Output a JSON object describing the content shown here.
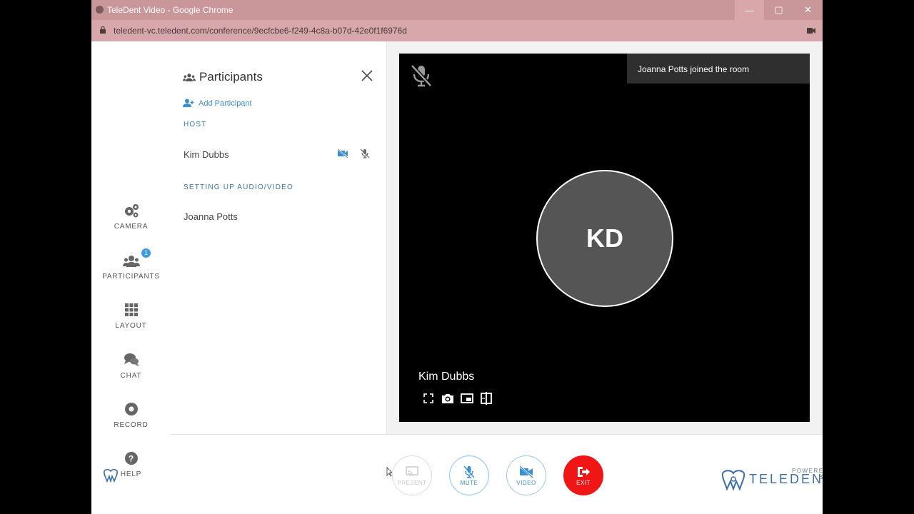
{
  "window": {
    "title": "TeleDent Video - Google Chrome",
    "url": "teledent-vc.teledent.com/conference/9ecfcbe6-f249-4c8a-b07d-42e0f1f6976d"
  },
  "leftnav": {
    "items": [
      {
        "label": "CAMERA",
        "icon": "gear-cogs-icon"
      },
      {
        "label": "PARTICIPANTS",
        "icon": "users-icon",
        "badge": "1"
      },
      {
        "label": "LAYOUT",
        "icon": "grid-icon"
      },
      {
        "label": "CHAT",
        "icon": "chat-icon"
      },
      {
        "label": "RECORD",
        "icon": "record-icon"
      },
      {
        "label": "HELP",
        "icon": "help-icon"
      }
    ]
  },
  "panel": {
    "title": "Participants",
    "add_label": "Add Participant",
    "host_heading": "HOST",
    "host_name": "Kim Dubbs",
    "setup_heading": "SETTING UP AUDIO/VIDEO",
    "setup_name": "Joanna Potts"
  },
  "stage": {
    "toast": "Joanna Potts joined the room",
    "initials": "KD",
    "name": "Kim Dubbs"
  },
  "controls": {
    "present": "PRESENT",
    "mute": "MUTE",
    "video": "VIDEO",
    "exit": "EXIT"
  },
  "brand": {
    "powered_by": "POWERED BY",
    "name": "TELEDENT"
  },
  "colors": {
    "accent": "#3c8ed0",
    "exit": "#f01616",
    "titlebar": "#c9969a"
  }
}
